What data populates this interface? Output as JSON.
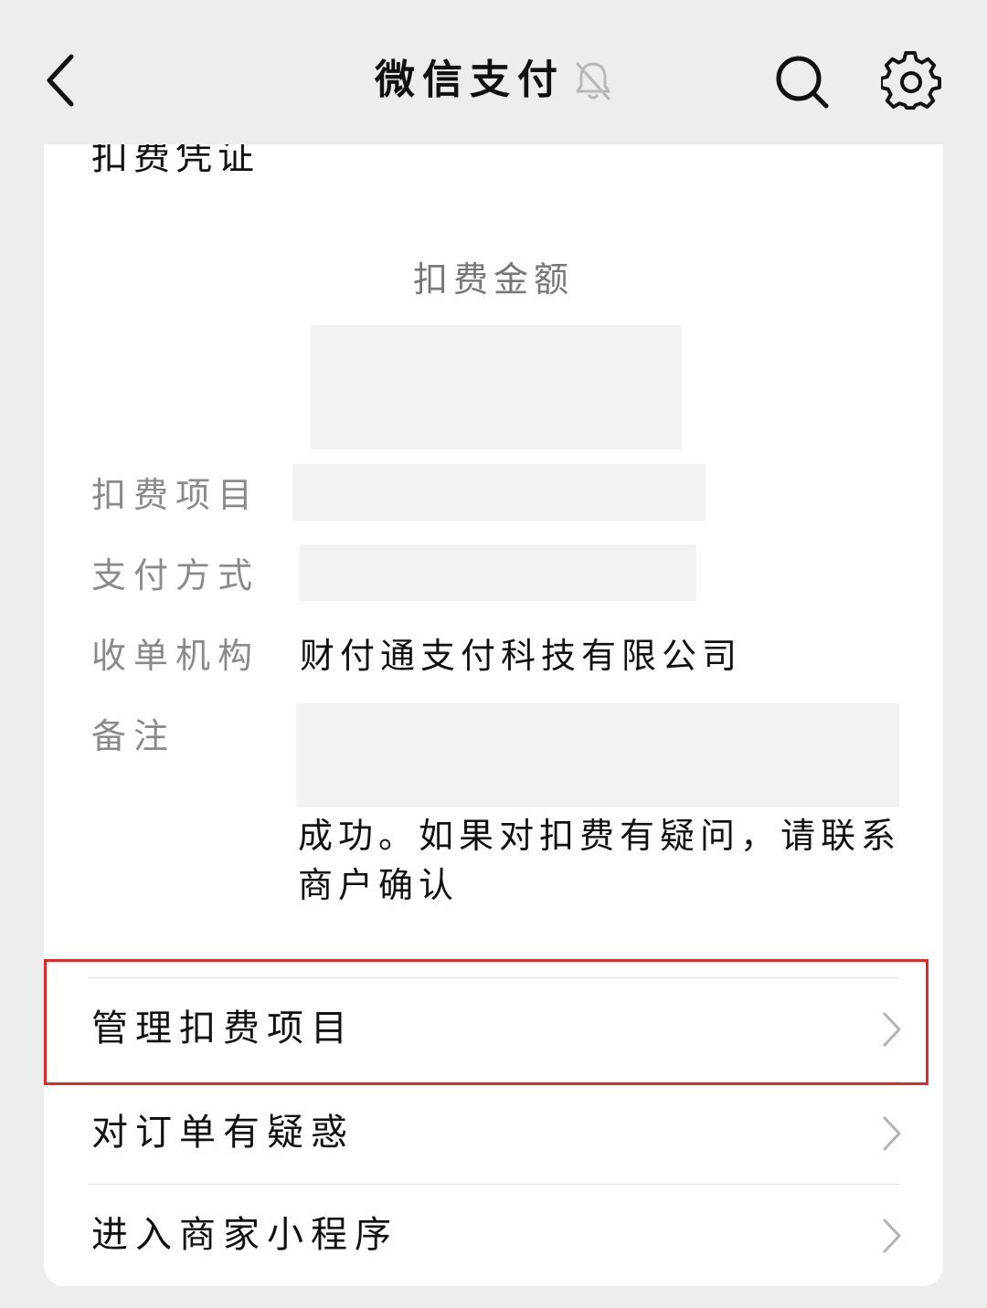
{
  "nav": {
    "title": "微信支付",
    "back_icon": "chevron-left-icon",
    "mute_icon": "bell-off-icon",
    "search_icon": "search-icon",
    "settings_icon": "gear-icon"
  },
  "voucher": {
    "title": "扣费凭证",
    "amount_label": "扣费金额",
    "fields": [
      {
        "label": "扣费项目",
        "value": ""
      },
      {
        "label": "支付方式",
        "value": ""
      },
      {
        "label": "收单机构",
        "value": "财付通支付科技有限公司"
      },
      {
        "label": "备注",
        "value": ""
      }
    ],
    "remark_tail_line1": "成功。如果对扣费有疑问，请联系",
    "remark_tail_line2": "商户确认"
  },
  "menu": [
    {
      "label": "管理扣费项目",
      "highlighted": true
    },
    {
      "label": "对订单有疑惑",
      "highlighted": false
    },
    {
      "label": "进入商家小程序",
      "highlighted": false
    }
  ],
  "colors": {
    "background": "#ededed",
    "card": "#ffffff",
    "redaction": "#f2f2f2",
    "highlight_border": "#e02a2a",
    "label_gray": "#8a8a8a"
  }
}
